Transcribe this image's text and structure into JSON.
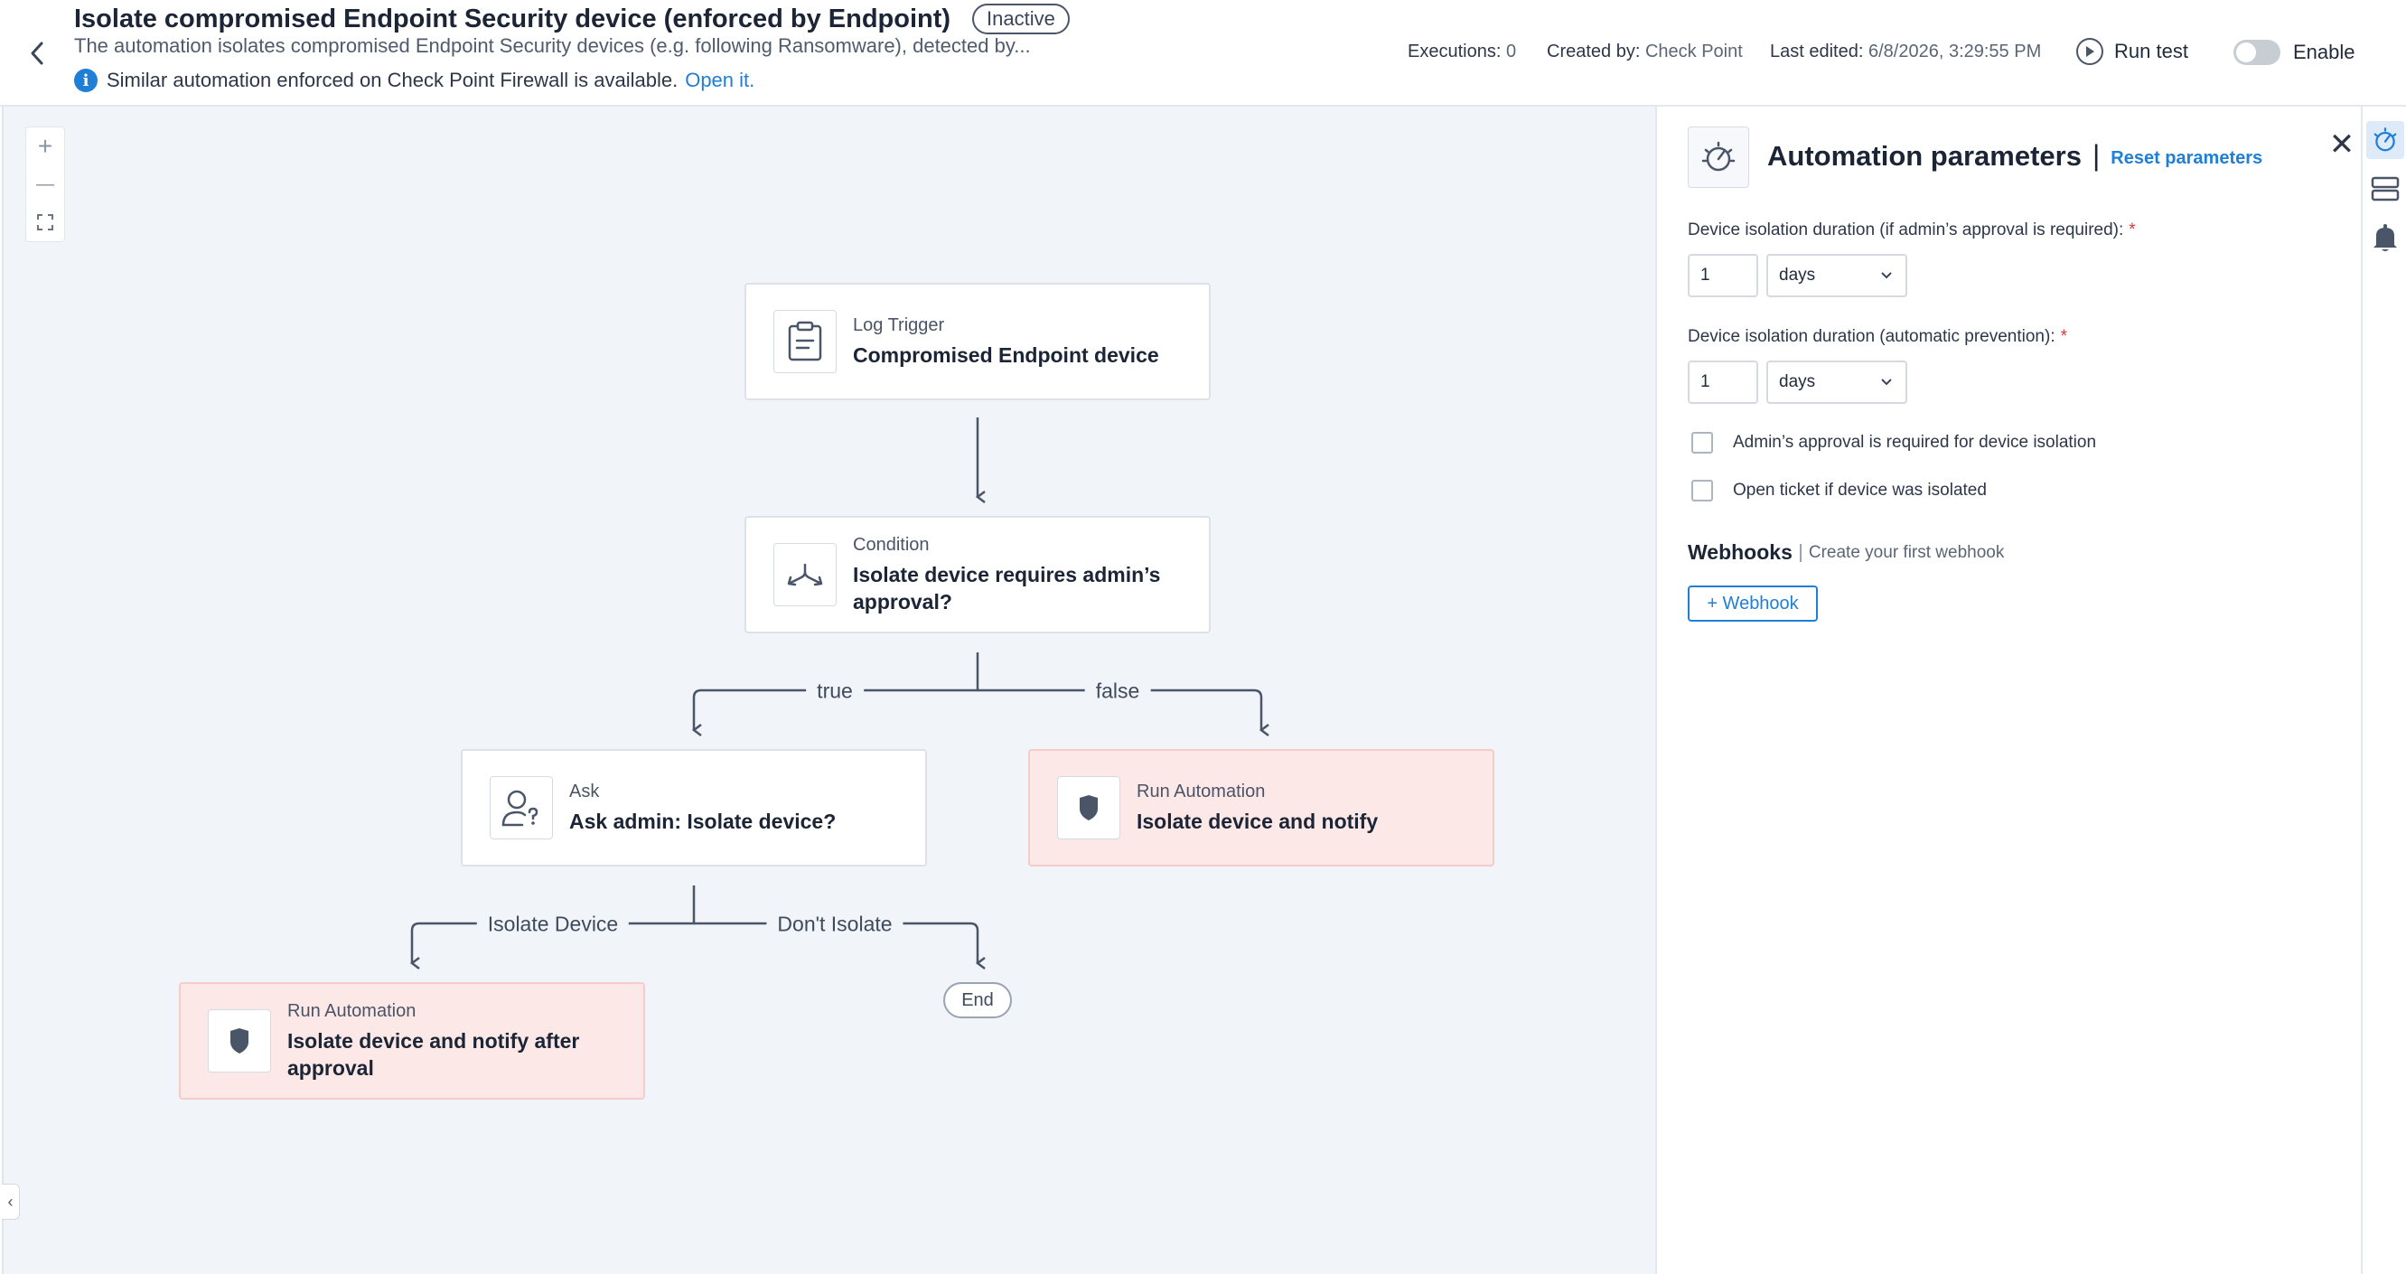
{
  "header": {
    "title": "Isolate compromised Endpoint Security device (enforced by Endpoint)",
    "status": "Inactive",
    "description": "The automation isolates compromised Endpoint Security devices (e.g. following Ransomware), detected by...",
    "notice_text": "Similar automation enforced on Check Point Firewall is available.",
    "notice_link": "Open it.",
    "executions_label": "Executions:",
    "executions_value": "0",
    "created_by_label": "Created by:",
    "created_by_value": "Check Point",
    "last_edited_label": "Last edited:",
    "last_edited_value": "6/8/2026, 3:29:55 PM",
    "run_test_label": "Run test",
    "enable_label": "Enable",
    "enabled": false
  },
  "canvas": {
    "zoom_in": "+",
    "zoom_out": "—",
    "fit": "⛶",
    "collapse": "‹"
  },
  "flow": {
    "trigger": {
      "type": "Log Trigger",
      "label": "Compromised Endpoint device"
    },
    "condition": {
      "type": "Condition",
      "label": "Isolate device requires admin’s approval?"
    },
    "true_label": "true",
    "false_label": "false",
    "ask": {
      "type": "Ask",
      "label": "Ask admin: Isolate device?"
    },
    "run_auto": {
      "type": "Run Automation",
      "label": "Isolate device and notify"
    },
    "isolate_label": "Isolate Device",
    "dont_isolate_label": "Don't Isolate",
    "run_after": {
      "type": "Run Automation",
      "label": "Isolate device and notify after approval"
    },
    "end_label": "End"
  },
  "panel": {
    "title": "Automation parameters",
    "separator": "|",
    "reset_label": "Reset parameters",
    "close": "✕",
    "field1_label": "Device isolation duration (if admin’s approval is required):",
    "field1_value": "1",
    "field1_unit": "days",
    "field2_label": "Device isolation duration (automatic prevention):",
    "field2_value": "1",
    "field2_unit": "days",
    "required_mark": "*",
    "check1_label": "Admin’s approval is required for device isolation",
    "check2_label": "Open ticket if device was isolated",
    "webhooks_title": "Webhooks",
    "webhooks_hint": "Create your first webhook",
    "webhook_button": "+ Webhook"
  },
  "colors": {
    "accent": "#1f7fd6",
    "run_node_bg": "#fde8e8",
    "canvas_bg": "#f1f4f9"
  }
}
